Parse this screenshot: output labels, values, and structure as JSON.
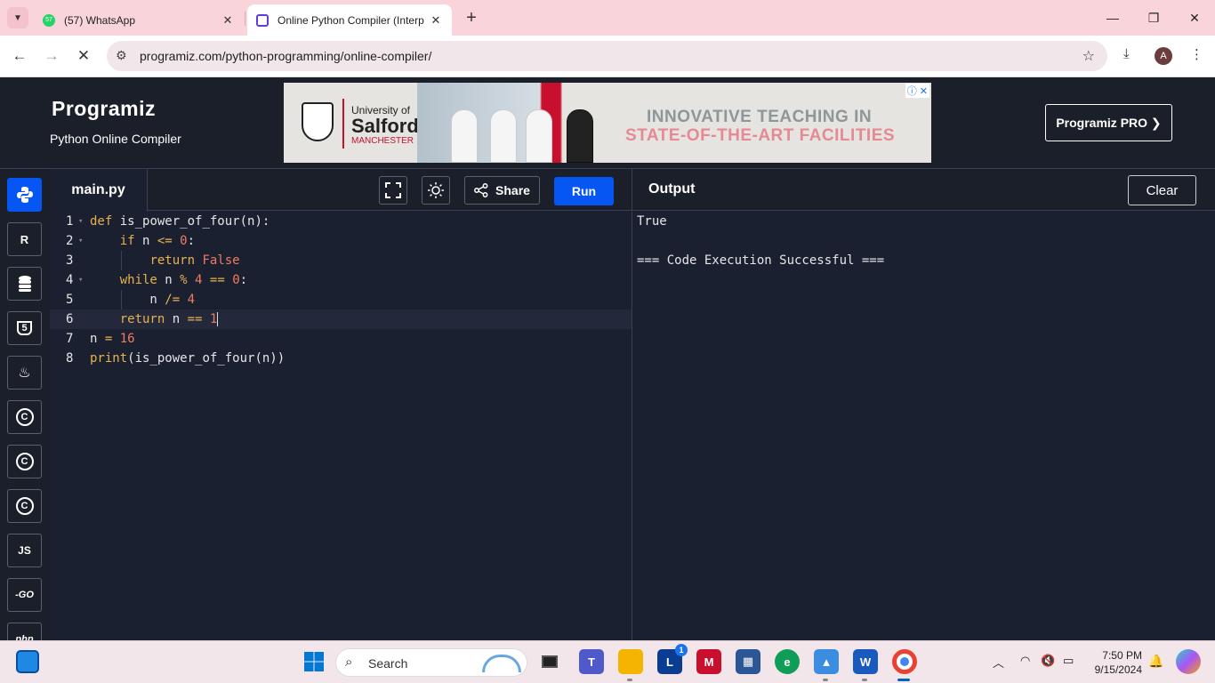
{
  "browser": {
    "tabs": [
      {
        "title": "(57) WhatsApp",
        "badge": "57",
        "active": false
      },
      {
        "title": "Online Python Compiler (Interp",
        "active": true
      }
    ],
    "url": "programiz.com/python-programming/online-compiler/",
    "profile_initial": "A"
  },
  "header": {
    "logo": "Programiz",
    "subtitle": "Python Online Compiler",
    "pro_button": "Programiz PRO ❯",
    "ad": {
      "uni_line1": "University of",
      "uni_line2": "Salford",
      "uni_line3": "MANCHESTER",
      "headline1": "INNOVATIVE TEACHING IN",
      "headline2": "STATE-OF-THE-ART FACILITIES"
    }
  },
  "languages": [
    {
      "name": "python",
      "label": ""
    },
    {
      "name": "r",
      "label": "R"
    },
    {
      "name": "sql",
      "label": ""
    },
    {
      "name": "html",
      "label": "5"
    },
    {
      "name": "java",
      "label": "♨"
    },
    {
      "name": "c",
      "label": "C"
    },
    {
      "name": "cpp",
      "label": "C"
    },
    {
      "name": "csharp",
      "label": "C"
    },
    {
      "name": "javascript",
      "label": "JS"
    },
    {
      "name": "go",
      "label": "-GO"
    },
    {
      "name": "php",
      "label": "php"
    }
  ],
  "editor": {
    "filename": "main.py",
    "share_label": "Share",
    "run_label": "Run",
    "lines": [
      "def is_power_of_four(n):",
      "    if n <= 0:",
      "        return False",
      "    while n % 4 == 0:",
      "        n /= 4",
      "    return n == 1",
      "n = 16",
      "print(is_power_of_four(n))"
    ],
    "current_line": 6
  },
  "output": {
    "title": "Output",
    "clear_label": "Clear",
    "lines": [
      "True",
      "",
      "=== Code Execution Successful ==="
    ]
  },
  "taskbar": {
    "search_placeholder": "Search",
    "time": "7:50 PM",
    "date": "9/15/2024",
    "lunar_badge": "1"
  }
}
